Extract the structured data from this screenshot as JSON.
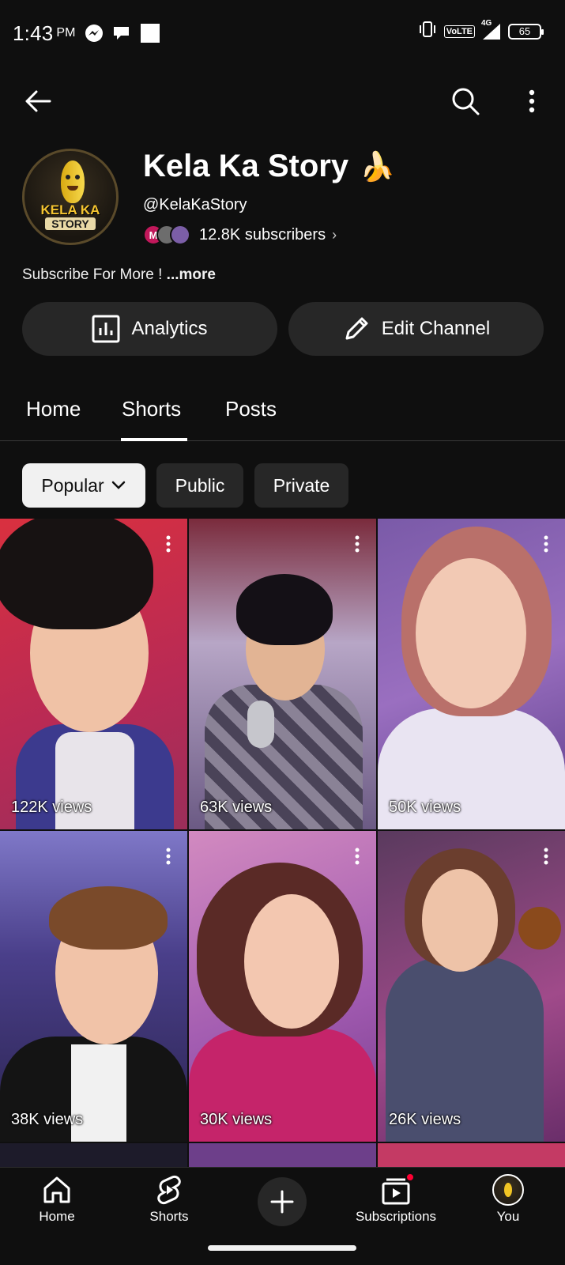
{
  "status_bar": {
    "time": "1:43",
    "ampm": "PM",
    "network_label": "VoLTE",
    "network_type": "4G",
    "battery": "65"
  },
  "channel": {
    "name": "Kela Ka Story",
    "name_emoji": "🍌",
    "avatar_text_line1": "KELA KA",
    "avatar_text_line2": "STORY",
    "handle": "@KelaKaStory",
    "subscriber_avatar_letter": "M",
    "subscribers": "12.8K subscribers",
    "description": "Subscribe For More ! ",
    "description_more": "...more"
  },
  "actions": {
    "analytics": "Analytics",
    "edit_channel": "Edit Channel"
  },
  "tabs": [
    {
      "label": "Home"
    },
    {
      "label": "Shorts",
      "selected": true
    },
    {
      "label": "Posts"
    }
  ],
  "filters": {
    "popular": "Popular",
    "public": "Public",
    "private": "Private"
  },
  "shorts": [
    {
      "views": "122K views"
    },
    {
      "views": "63K views"
    },
    {
      "views": "50K views"
    },
    {
      "views": "38K views"
    },
    {
      "views": "30K views"
    },
    {
      "views": "26K views"
    }
  ],
  "nav": {
    "home": "Home",
    "shorts": "Shorts",
    "subscriptions": "Subscriptions",
    "you": "You"
  },
  "colors": {
    "background": "#0f0f0f",
    "button_bg": "#272727",
    "accent_red": "#ff0033"
  }
}
